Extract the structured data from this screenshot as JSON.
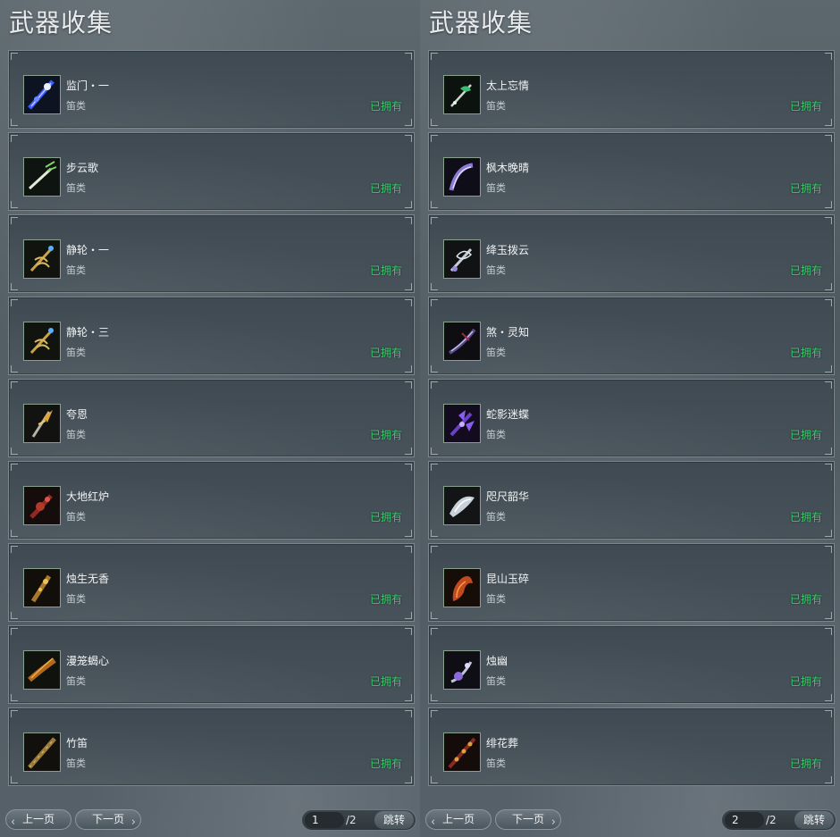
{
  "colors": {
    "owned": "#35d06a",
    "frame": "#7a8791"
  },
  "panels": [
    {
      "title": "武器收集",
      "items": [
        {
          "name": "监门・一",
          "type": "笛类",
          "status": "已拥有",
          "icon": "flute-blue-icon"
        },
        {
          "name": "步云歌",
          "type": "笛类",
          "status": "已拥有",
          "icon": "flute-white-icon"
        },
        {
          "name": "静轮・一",
          "type": "笛类",
          "status": "已拥有",
          "icon": "flute-gold-wheel-icon"
        },
        {
          "name": "静轮・三",
          "type": "笛类",
          "status": "已拥有",
          "icon": "flute-gold-wheel-icon"
        },
        {
          "name": "夸恩",
          "type": "笛类",
          "status": "已拥有",
          "icon": "flute-gold-icon"
        },
        {
          "name": "大地红炉",
          "type": "笛类",
          "status": "已拥有",
          "icon": "flute-red-icon"
        },
        {
          "name": "烛生无香",
          "type": "笛类",
          "status": "已拥有",
          "icon": "flute-amber-icon"
        },
        {
          "name": "漫笼蝎心",
          "type": "笛类",
          "status": "已拥有",
          "icon": "flute-bronze-icon"
        },
        {
          "name": "竹笛",
          "type": "笛类",
          "status": "已拥有",
          "icon": "bamboo-flute-icon"
        }
      ],
      "pager": {
        "prev": "上一页",
        "next": "下一页",
        "page": "1",
        "total": "/2",
        "jump": "跳转"
      }
    },
    {
      "title": "武器收集",
      "items": [
        {
          "name": "太上忘情",
          "type": "笛类",
          "status": "已拥有",
          "icon": "flute-jade-icon"
        },
        {
          "name": "枫木晚晴",
          "type": "笛类",
          "status": "已拥有",
          "icon": "flute-violet-icon"
        },
        {
          "name": "绛玉拨云",
          "type": "笛类",
          "status": "已拥有",
          "icon": "flute-silver-icon"
        },
        {
          "name": "煞・灵知",
          "type": "笛类",
          "status": "已拥有",
          "icon": "flute-dark-icon"
        },
        {
          "name": "蛇影迷蝶",
          "type": "笛类",
          "status": "已拥有",
          "icon": "flute-purple-icon"
        },
        {
          "name": "咫尺韶华",
          "type": "笛类",
          "status": "已拥有",
          "icon": "flute-white-dragon-icon"
        },
        {
          "name": "昆山玉碎",
          "type": "笛类",
          "status": "已拥有",
          "icon": "flute-flame-icon"
        },
        {
          "name": "烛幽",
          "type": "笛类",
          "status": "已拥有",
          "icon": "flute-ghost-icon"
        },
        {
          "name": "绯花葬",
          "type": "笛类",
          "status": "已拥有",
          "icon": "flute-crimson-icon"
        }
      ],
      "pager": {
        "prev": "上一页",
        "next": "下一页",
        "page": "2",
        "total": "/2",
        "jump": "跳转"
      }
    }
  ]
}
